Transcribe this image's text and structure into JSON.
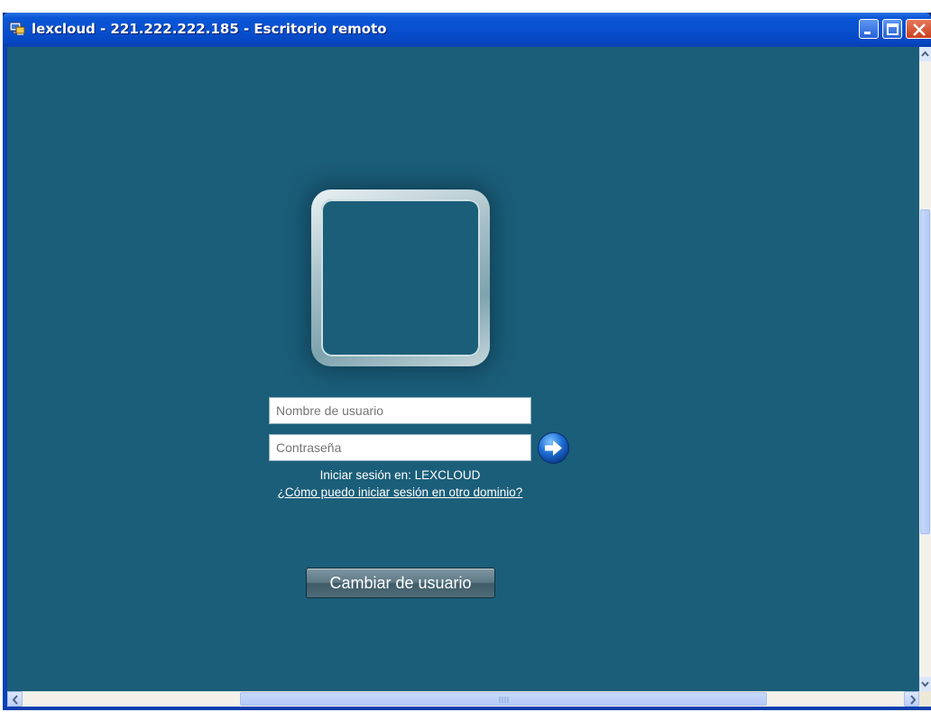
{
  "window": {
    "title": "lexcloud - 221.222.222.185 - Escritorio remoto",
    "icon": "remote-desktop-icon",
    "controls": [
      "minimize-icon",
      "maximize-icon",
      "close-icon"
    ]
  },
  "login": {
    "avatar": "user-picture-frame",
    "username_placeholder": "Nombre de usuario",
    "password_placeholder": "Contraseña",
    "submit_icon": "arrow-right-icon",
    "domain_text": "Iniciar sesión en: LEXCLOUD",
    "other_domain_link": "¿Cómo puedo iniciar sesión en otro dominio?",
    "switch_user_label": "Cambiar de usuario"
  },
  "colors": {
    "desktop_background": "#1b5e79",
    "titlebar": "#0850cf"
  }
}
